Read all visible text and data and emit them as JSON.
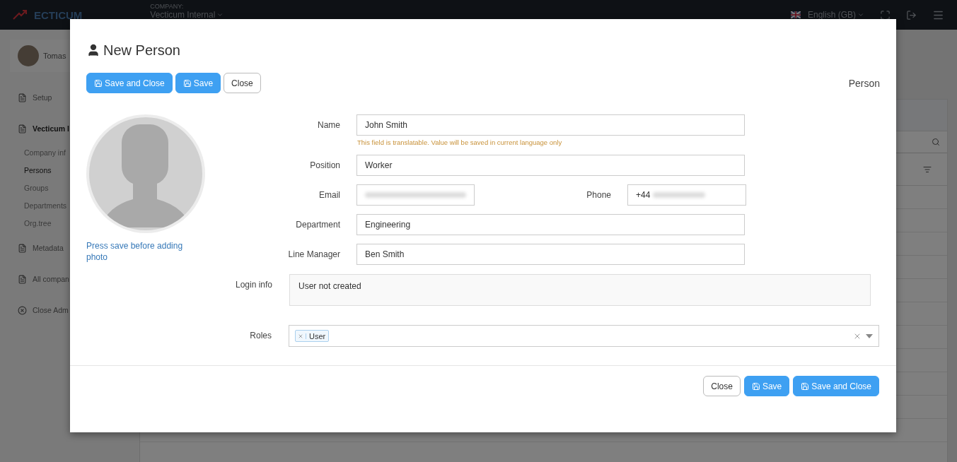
{
  "topbar": {
    "logo": "ECTICUM",
    "company_label": "COMPANY:",
    "company": "Vecticum Internal",
    "language": "English (GB)"
  },
  "sidebar": {
    "user": "Tomas",
    "items": [
      {
        "label": "Setup",
        "kind": "section",
        "selected": false
      },
      {
        "label": "Vecticum I",
        "kind": "section",
        "selected": true,
        "children": [
          {
            "label": "Company inf",
            "selected": false
          },
          {
            "label": "Persons",
            "selected": true
          },
          {
            "label": "Groups",
            "selected": false
          },
          {
            "label": "Departments",
            "selected": false
          },
          {
            "label": "Org.tree",
            "selected": false
          }
        ]
      },
      {
        "label": "Metadata",
        "kind": "section",
        "selected": false
      },
      {
        "label": "All compan",
        "kind": "section",
        "selected": false
      },
      {
        "label": "Close Adm",
        "kind": "close",
        "selected": false
      }
    ]
  },
  "dialog": {
    "title": "New Person",
    "entity": "Person",
    "toolbar": [
      {
        "label": "Save and Close",
        "kind": "primary"
      },
      {
        "label": "Save",
        "kind": "primary"
      },
      {
        "label": "Close",
        "kind": "plain"
      }
    ],
    "photo_hint": "Press save before adding photo",
    "fields": [
      {
        "kind": "single",
        "label": "Name",
        "value": "John Smith",
        "hint": "This field is translatable. Value will be saved in current language only"
      },
      {
        "kind": "single",
        "label": "Position",
        "value": "Worker"
      },
      {
        "kind": "pair",
        "label": "Email",
        "redacted": true,
        "label_2": "Phone",
        "value_2": "+44",
        "redacted_2": true
      },
      {
        "kind": "single",
        "label": "Department",
        "value": "Engineering"
      },
      {
        "kind": "single",
        "label": "Line Manager",
        "value": "Ben Smith"
      }
    ],
    "login_info": {
      "label": "Login info",
      "value": "User not created"
    },
    "roles": {
      "label": "Roles",
      "tags": [
        "User"
      ]
    },
    "footer": [
      {
        "label": "Close",
        "kind": "plain"
      },
      {
        "label": "Save",
        "kind": "primary"
      },
      {
        "label": "Save and Close",
        "kind": "primary"
      }
    ]
  }
}
